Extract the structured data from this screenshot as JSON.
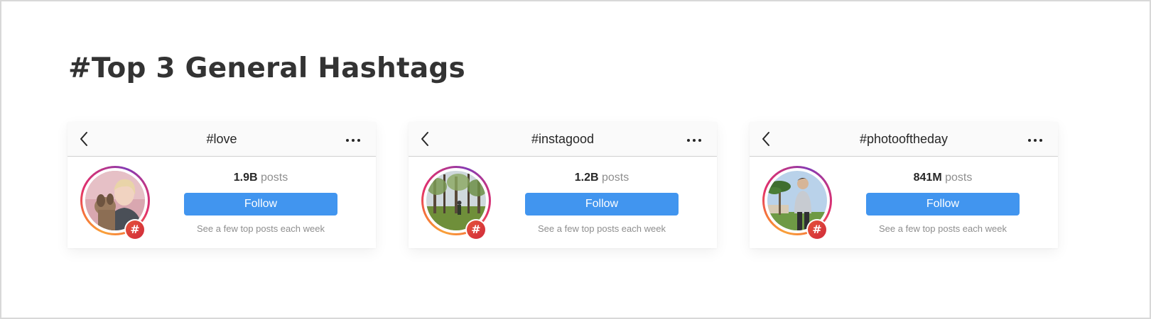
{
  "page": {
    "title": "#Top 3 General Hashtags"
  },
  "cards": [
    {
      "hashtag": "#love",
      "count": "1.9B",
      "count_unit": "posts",
      "follow_label": "Follow",
      "subtext": "See a few top posts each week",
      "avatar_icon": "woman-with-dog-photo"
    },
    {
      "hashtag": "#instagood",
      "count": "1.2B",
      "count_unit": "posts",
      "follow_label": "Follow",
      "subtext": "See a few top posts each week",
      "avatar_icon": "forest-photo"
    },
    {
      "hashtag": "#photooftheday",
      "count": "841M",
      "count_unit": "posts",
      "follow_label": "Follow",
      "subtext": "See a few top posts each week",
      "avatar_icon": "man-with-palm-trees-photo"
    }
  ],
  "icons": {
    "back": "chevron-left-icon",
    "more": "more-horizontal-icon",
    "badge": "hashtag-icon",
    "badge_glyph": "#"
  },
  "colors": {
    "follow_button": "#4195ef",
    "title_text": "#333333",
    "badge": "#e0413a",
    "ring_start": "#f9a13a",
    "ring_end": "#c13584"
  }
}
